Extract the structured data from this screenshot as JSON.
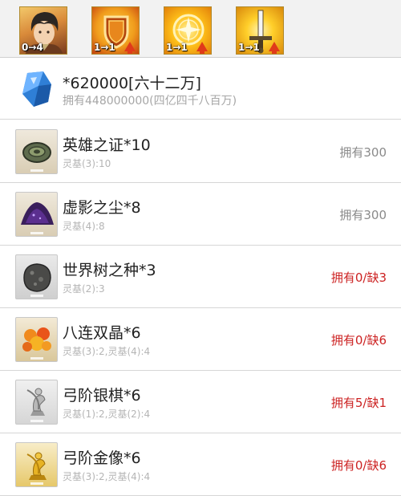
{
  "colors": {
    "owned_ok": "#8a8a8a",
    "owned_lack": "#cc2222",
    "muted": "#b5b5b5"
  },
  "skills": [
    {
      "icon": "servant-portrait-icon",
      "level": "0→4"
    },
    {
      "icon": "shield-skill-icon",
      "level": "1→1"
    },
    {
      "icon": "sun-compass-skill-icon",
      "level": "1→1"
    },
    {
      "icon": "sword-skill-icon",
      "level": "1→1"
    }
  ],
  "qp": {
    "icon": "crystal-icon",
    "title": "*620000[六十二万]",
    "owned": "拥有448000000(四亿四千八百万)"
  },
  "items": [
    {
      "icon": "heros-proof-icon",
      "name": "英雄之证*10",
      "req": "灵基(3):10",
      "status": "拥有300",
      "state": "ok"
    },
    {
      "icon": "void-dust-icon",
      "name": "虚影之尘*8",
      "req": "灵基(4):8",
      "status": "拥有300",
      "state": "ok"
    },
    {
      "icon": "seed-of-yggdrasil-icon",
      "name": "世界树之种*3",
      "req": "灵基(2):3",
      "status": "拥有0/缺3",
      "state": "lack"
    },
    {
      "icon": "octuplet-crystal-icon",
      "name": "八连双晶*6",
      "req": "灵基(3):2,灵基(4):4",
      "status": "拥有0/缺6",
      "state": "lack"
    },
    {
      "icon": "archer-silver-piece-icon",
      "name": "弓阶银棋*6",
      "req": "灵基(1):2,灵基(2):4",
      "status": "拥有5/缺1",
      "state": "lack"
    },
    {
      "icon": "archer-gold-statue-icon",
      "name": "弓阶金像*6",
      "req": "灵基(3):2,灵基(4):4",
      "status": "拥有0/缺6",
      "state": "lack"
    }
  ]
}
